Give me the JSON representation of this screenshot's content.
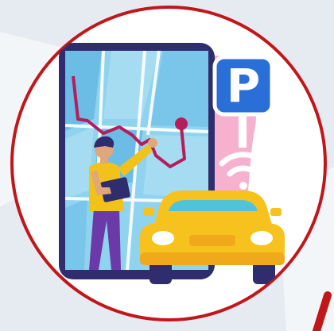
{
  "parking_sign": {
    "letter": "P"
  },
  "colors": {
    "ring": "#c0171b",
    "circle_fill": "#ffffff",
    "backdrop": "#e6ebf1",
    "phone_body": "#2f2d6e",
    "map_water": "#7fc8ea",
    "route": "#b51d5c",
    "parking_sign": "#2a6fd8",
    "car_body": "#f7c21d",
    "car_windshield": "#4fc3d8",
    "wifi": "#ffffff",
    "person_shirt": "#f3c21a",
    "person_pants": "#6b3aa8",
    "pink_blob": "#f4a3c6"
  },
  "icons": [
    "smartphone-map-icon",
    "parking-sign-icon",
    "wifi-signal-icon",
    "car-icon",
    "person-icon",
    "tablet-icon",
    "route-pin-icon"
  ]
}
